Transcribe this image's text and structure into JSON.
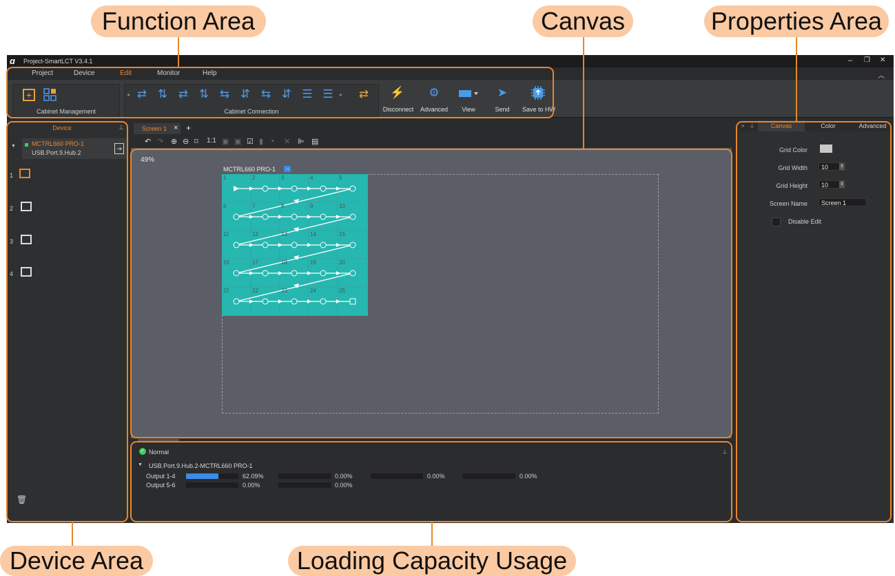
{
  "callouts": {
    "function_area": "Function Area",
    "canvas": "Canvas",
    "properties_area": "Properties Area",
    "device_area": "Device Area",
    "loading_capacity": "Loading Capacity Usage"
  },
  "titlebar": {
    "title": "Project-SmartLCT V3.4.1",
    "min": "–",
    "restore": "❐",
    "close": "✕",
    "collapse": "^"
  },
  "menu": {
    "items": [
      "Project",
      "Device",
      "Edit",
      "Monitor",
      "Help"
    ],
    "active": "Edit",
    "active_color": "#e9862c"
  },
  "ribbon": {
    "cabinet_management": "Cabinet Management",
    "cabinet_connection": "Cabinet Connection",
    "disconnect": "Disconnect",
    "advanced": "Advanced",
    "view": "View",
    "send": "Send",
    "save_hw": "Save to HW"
  },
  "device_panel": {
    "title": "Device",
    "controller": "MCTRL660 PRO-1",
    "port": "USB.Port.9.Hub.2",
    "ports": [
      "1",
      "2",
      "3",
      "4"
    ]
  },
  "tabs": {
    "screen": "Screen 1",
    "close": "×",
    "add": "+"
  },
  "canvas": {
    "zoom": "49%",
    "controller_label": "MCTRL660 PRO-1",
    "cabinet_color": "#26b7b0",
    "cabinets": [
      "1",
      "2",
      "3",
      "4",
      "5",
      "6",
      "7",
      "8",
      "9",
      "10",
      "11",
      "12",
      "13",
      "14",
      "15",
      "16",
      "17",
      "18",
      "19",
      "20",
      "21",
      "22",
      "23",
      "24",
      "25"
    ]
  },
  "toolbar": {
    "one_to_one": "1:1"
  },
  "status": {
    "state": "Normal",
    "device_path": "USB.Port.9.Hub.2-MCTRL660 PRO-1",
    "rows": [
      {
        "label": "Output 1-4",
        "values": [
          {
            "pct": "62.09%",
            "fill": 0.6209
          },
          {
            "pct": "0.00%",
            "fill": 0
          },
          {
            "pct": "0.00%",
            "fill": 0
          },
          {
            "pct": "0.00%",
            "fill": 0
          }
        ]
      },
      {
        "label": "Output 5-6",
        "values": [
          {
            "pct": "0.00%",
            "fill": 0
          },
          {
            "pct": "0.00%",
            "fill": 0
          }
        ]
      }
    ]
  },
  "properties": {
    "tabs": [
      "Canvas",
      "Color",
      "Advanced"
    ],
    "grid_color_label": "Grid Color",
    "grid_width_label": "Grid Width",
    "grid_width": "10",
    "grid_height_label": "Grid Height",
    "grid_height": "10",
    "screen_name_label": "Screen Name",
    "screen_name": "Screen 1",
    "disable_edit": "Disable Edit"
  }
}
